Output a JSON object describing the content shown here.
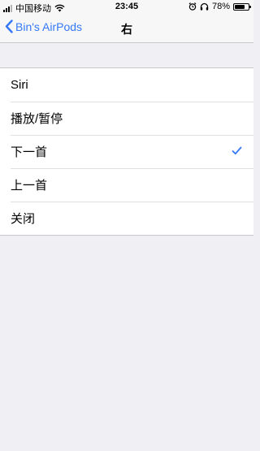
{
  "status_bar": {
    "carrier": "中国移动",
    "time": "23:45",
    "battery": "78%",
    "battery_level": 0.78
  },
  "nav": {
    "back_label": "Bin's AirPods",
    "title": "右"
  },
  "options": [
    {
      "label": "Siri",
      "selected": false
    },
    {
      "label": "播放/暂停",
      "selected": false
    },
    {
      "label": "下一首",
      "selected": true
    },
    {
      "label": "上一首",
      "selected": false
    },
    {
      "label": "关闭",
      "selected": false
    }
  ],
  "colors": {
    "accent": "#3478f6",
    "background": "#efeff4"
  }
}
